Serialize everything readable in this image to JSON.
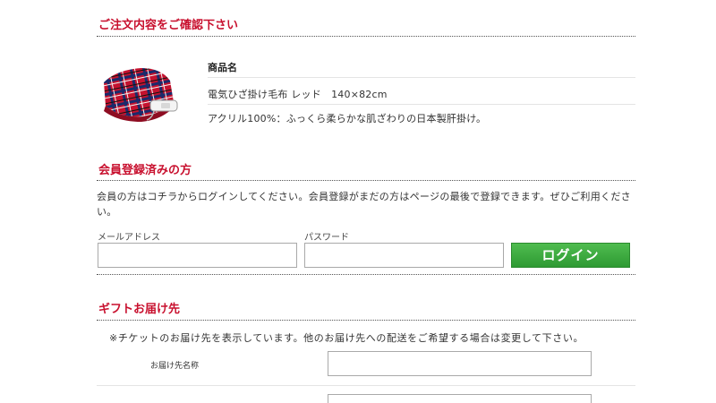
{
  "order_confirm": {
    "title": "ご注文内容をご確認下さい",
    "product_header": "商品名",
    "product_name": "電気ひざ掛け毛布 レッド　140×82cm",
    "product_desc": "アクリル100%：ふっくら柔らかな肌ざわりの日本製肝掛け。"
  },
  "member": {
    "title": "会員登録済みの方",
    "note": "会員の方はコチラからログインしてください。会員登録がまだの方はページの最後で登録できます。ぜひご利用ください。",
    "email_label": "メールアドレス",
    "email_value": "",
    "password_label": "パスワード",
    "password_value": "",
    "login_label": "ログイン"
  },
  "gift": {
    "title": "ギフトお届け先",
    "note": "※チケットのお届け先を表示しています。他のお届け先への配送をご希望する場合は変更して下さい。",
    "recipient_label": "お届け先名称",
    "recipient_value": "",
    "second_value": ""
  },
  "colors": {
    "accent": "#c8102e",
    "login_button": "#3aa83e"
  }
}
